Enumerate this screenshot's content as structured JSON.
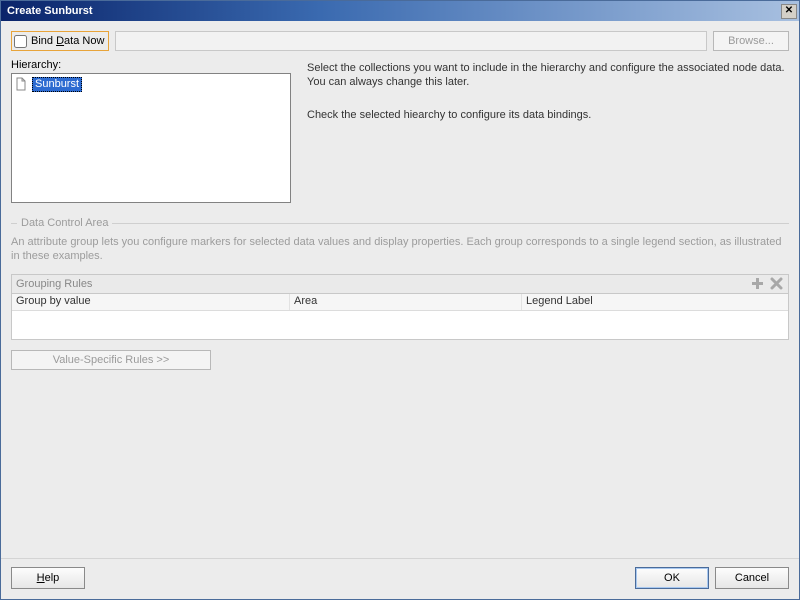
{
  "title": "Create Sunburst",
  "bind_row": {
    "checkbox_label_pre": "Bind ",
    "checkbox_label_ul": "D",
    "checkbox_label_post": "ata Now",
    "browse": "Browse..."
  },
  "hierarchy": {
    "label": "Hierarchy:",
    "item": "Sunburst"
  },
  "info": {
    "p1": "Select the collections you want to include in the hierarchy and configure the associated node data. You can always change this later.",
    "p2": "Check the selected hiearchy to configure its data bindings."
  },
  "data_control": {
    "title": "Data Control Area",
    "desc": "An attribute group lets you configure markers for selected data values and display properties. Each group corresponds to a single legend section, as illustrated in these examples."
  },
  "grouping": {
    "title": "Grouping Rules",
    "cols": {
      "c1": "Group by value",
      "c2": "Area",
      "c3": "Legend Label"
    },
    "value_rules": "Value-Specific Rules >>"
  },
  "footer": {
    "help_ul": "H",
    "help_rest": "elp",
    "ok": "OK",
    "cancel": "Cancel"
  }
}
